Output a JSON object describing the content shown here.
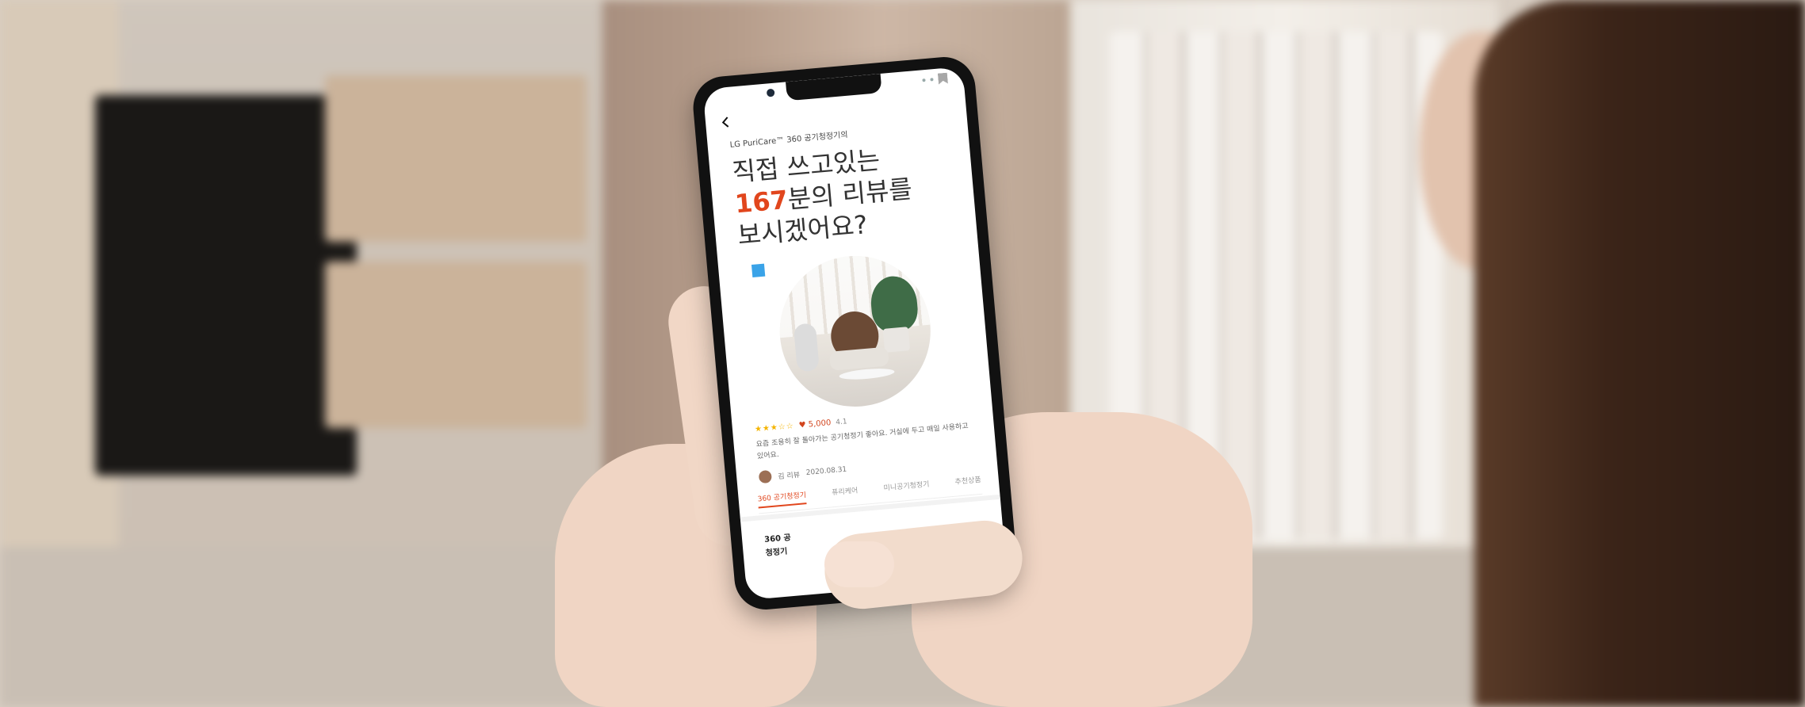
{
  "phone": {
    "breadcrumb": "LG PuriCare™ 360 공기청정기의",
    "headline": {
      "line1": "직접 쓰고있는",
      "number": "167",
      "line2_rest": "분의 리뷰를",
      "line3": "보시겠어요?"
    },
    "review": {
      "stars": "★★★☆☆",
      "likes": "♥ 5,000",
      "label": "4.1",
      "text": "요즘 조용히 잘 돌아가는 공기청정기 좋아요. 거실에 두고 매일 사용하고 있어요.",
      "author": "김 리뷰",
      "date": "2020.08.31"
    },
    "tabs": [
      "360 공기청정기",
      "퓨리케어",
      "미니공기청정기",
      "추천상품"
    ],
    "bottom_line1": "360 공",
    "bottom_line2": "청정기"
  },
  "colors": {
    "accent": "#e1461d",
    "badge": "#3aa3e8"
  },
  "icons": {
    "back": "back-chevron-icon",
    "bookmark": "bookmark-icon"
  }
}
